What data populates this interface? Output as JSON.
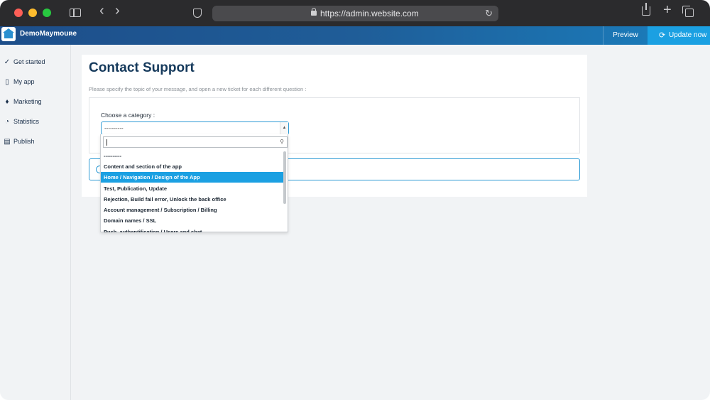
{
  "browser": {
    "url": "https://admin.website.com"
  },
  "app": {
    "name": "DemoMaymoune",
    "preview_label": "Preview",
    "update_label": "Update now"
  },
  "sidebar": {
    "items": [
      {
        "label": "Get started",
        "icon": "check-circle-icon"
      },
      {
        "label": "My app",
        "icon": "phone-icon"
      },
      {
        "label": "Marketing",
        "icon": "bell-icon"
      },
      {
        "label": "Statistics",
        "icon": "pie-chart-icon"
      },
      {
        "label": "Publish",
        "icon": "store-icon"
      }
    ]
  },
  "main": {
    "title": "Contact Support",
    "subtitle": "Please specify the topic of your message, and open a new ticket for each different question :",
    "category_label": "Choose a category :",
    "selected_value": "----------"
  },
  "dropdown": {
    "search_value": "",
    "options": [
      "----------",
      "Content and section of the app",
      "Home / Navigation / Design of the App",
      "Test, Publication, Update",
      "Rejection, Build fail error, Unlock the back office",
      "Account management / Subscription / Billing",
      "Domain names / SSL",
      "Push, authentification / Users and chat"
    ],
    "highlighted_index": 2
  },
  "colors": {
    "accent": "#1ba0e2",
    "title": "#163a5c",
    "header_start": "#1d4e8a"
  }
}
